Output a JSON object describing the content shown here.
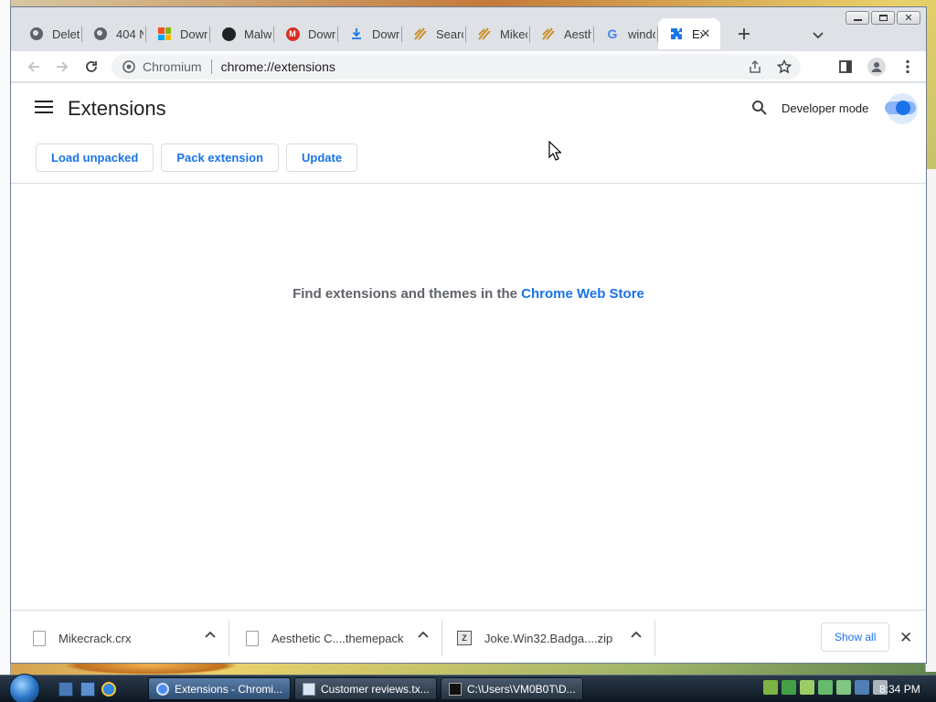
{
  "tabs": [
    {
      "title": "Delete",
      "icon": "globe-icon"
    },
    {
      "title": "404 N",
      "icon": "globe-icon"
    },
    {
      "title": "Down",
      "icon": "microsoft-icon"
    },
    {
      "title": "Malw",
      "icon": "github-icon"
    },
    {
      "title": "Down",
      "icon": "red-m-icon"
    },
    {
      "title": "Down",
      "icon": "download-icon"
    },
    {
      "title": "Searc",
      "icon": "theme-icon"
    },
    {
      "title": "Mikec",
      "icon": "theme-icon"
    },
    {
      "title": "Aesth",
      "icon": "theme-icon"
    },
    {
      "title": "windo",
      "icon": "google-icon"
    },
    {
      "title": "Ex",
      "icon": "puzzle-icon",
      "active": true
    }
  ],
  "toolbar": {
    "site_label": "Chromium",
    "url": "chrome://extensions"
  },
  "page": {
    "title": "Extensions",
    "developer_mode_label": "Developer mode",
    "developer_mode_on": true,
    "buttons": {
      "load_unpacked": "Load unpacked",
      "pack_extension": "Pack extension",
      "update": "Update"
    },
    "empty_prefix": "Find extensions and themes in the",
    "empty_link": "Chrome Web Store"
  },
  "downloads": {
    "items": [
      {
        "name": "Mikecrack.crx",
        "icon": "file-icon"
      },
      {
        "name": "Aesthetic C....themepack",
        "icon": "file-icon"
      },
      {
        "name": "Joke.Win32.Badga....zip",
        "icon": "zip-icon"
      }
    ],
    "show_all": "Show all"
  },
  "taskbar": {
    "tasks": [
      {
        "label": "Extensions - Chromi...",
        "active": true
      },
      {
        "label": "Customer reviews.tx..."
      },
      {
        "label": "C:\\Users\\VM0B0T\\D..."
      }
    ],
    "clock": "8:34 PM"
  },
  "colors": {
    "accent": "#1a73e8",
    "tab_strip": "#dee1e6"
  }
}
